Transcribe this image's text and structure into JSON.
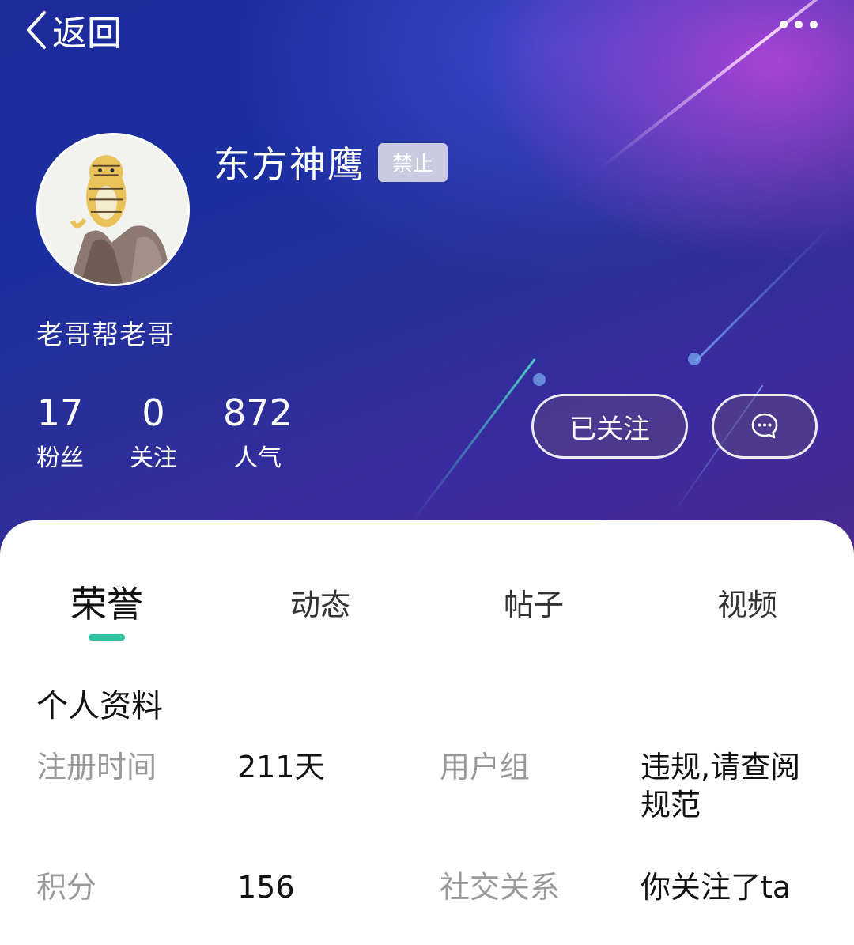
{
  "topbar": {
    "back_label": "返回"
  },
  "profile": {
    "username": "东方神鹰",
    "status_badge": "禁止",
    "bio": "老哥帮老哥",
    "stats": [
      {
        "value": "17",
        "label": "粉丝"
      },
      {
        "value": "0",
        "label": "关注"
      },
      {
        "value": "872",
        "label": "人气"
      }
    ],
    "follow_label": "已关注"
  },
  "tabs": [
    {
      "label": "荣誉",
      "active": true
    },
    {
      "label": "动态",
      "active": false
    },
    {
      "label": "帖子",
      "active": false
    },
    {
      "label": "视频",
      "active": false
    }
  ],
  "details": {
    "title": "个人资料",
    "rows": [
      {
        "label1": "注册时间",
        "value1": "211天",
        "label2": "用户组",
        "value2": "违规,请查阅规范"
      },
      {
        "label1": "积分",
        "value1": "156",
        "label2": "社交关系",
        "value2": "你关注了ta"
      }
    ]
  },
  "colors": {
    "accent": "#2fc3a0",
    "hero_bg": "#1e2a9a"
  },
  "icons": [
    "back-arrow-icon",
    "more-dots-icon",
    "message-bubble-icon"
  ]
}
